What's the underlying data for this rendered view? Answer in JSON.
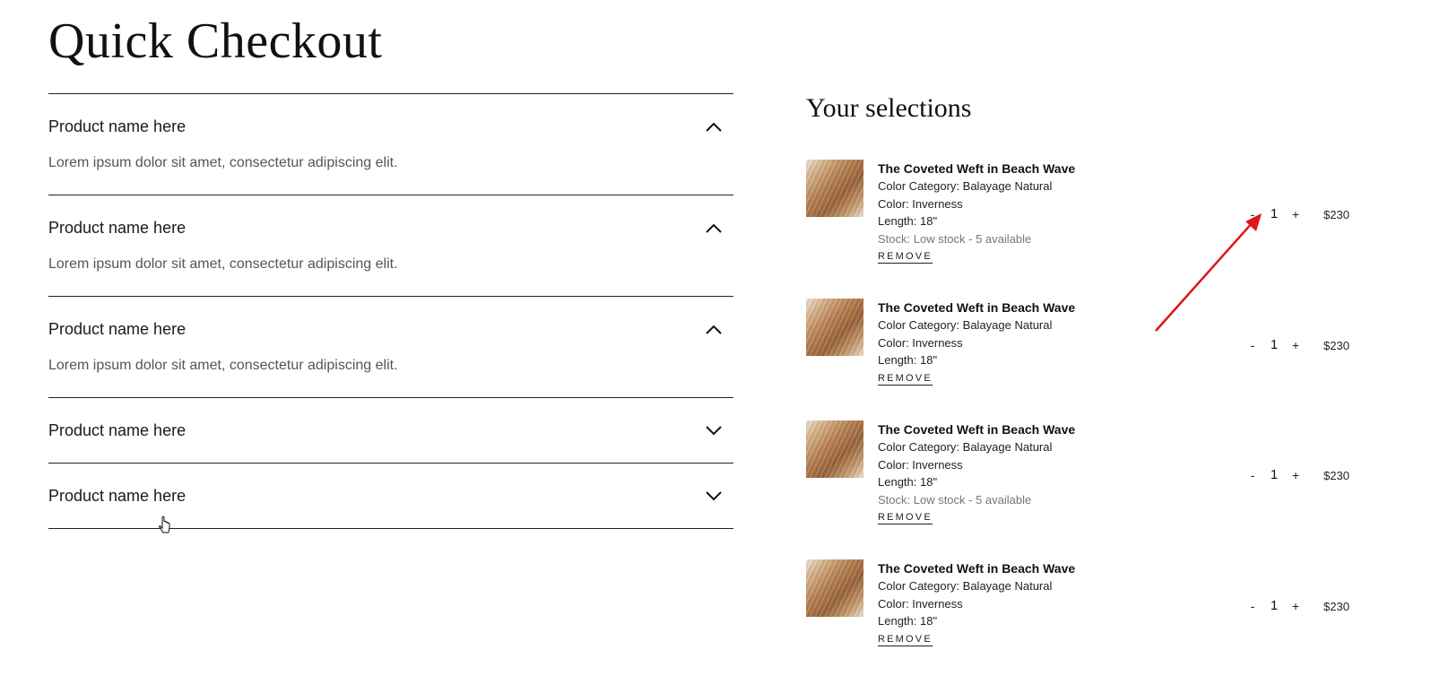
{
  "page_title": "Quick Checkout",
  "accordion": [
    {
      "title": "Product name here",
      "expanded": true,
      "body": "Lorem ipsum dolor sit amet, consectetur adipiscing elit."
    },
    {
      "title": "Product name here",
      "expanded": true,
      "body": "Lorem ipsum dolor sit amet, consectetur adipiscing elit."
    },
    {
      "title": "Product name here",
      "expanded": true,
      "body": "Lorem ipsum dolor sit amet, consectetur adipiscing elit."
    },
    {
      "title": "Product name here",
      "expanded": false
    },
    {
      "title": "Product name here",
      "expanded": false
    }
  ],
  "selections": {
    "title": "Your selections",
    "items": [
      {
        "name": "The Coveted Weft in Beach Wave",
        "color_category": "Color Category: Balayage Natural",
        "color": "Color: Inverness",
        "length": "Length: 18\"",
        "stock": "Stock: Low stock - 5 available",
        "remove_label": "REMOVE",
        "qty_minus": "-",
        "quantity": "1",
        "qty_plus": "+",
        "price": "$230"
      },
      {
        "name": "The Coveted Weft in Beach Wave",
        "color_category": "Color Category: Balayage Natural",
        "color": "Color: Inverness",
        "length": "Length: 18\"",
        "remove_label": "REMOVE",
        "qty_minus": "-",
        "quantity": "1",
        "qty_plus": "+",
        "price": "$230"
      },
      {
        "name": "The Coveted Weft in Beach Wave",
        "color_category": "Color Category: Balayage Natural",
        "color": "Color: Inverness",
        "length": "Length: 18\"",
        "stock": "Stock: Low stock - 5 available",
        "remove_label": "REMOVE",
        "qty_minus": "-",
        "quantity": "1",
        "qty_plus": "+",
        "price": "$230"
      },
      {
        "name": "The Coveted Weft in Beach Wave",
        "color_category": "Color Category: Balayage Natural",
        "color": "Color: Inverness",
        "length": "Length: 18\"",
        "remove_label": "REMOVE",
        "qty_minus": "-",
        "quantity": "1",
        "qty_plus": "+",
        "price": "$230"
      }
    ]
  },
  "colors": {
    "annotation_arrow": "#e0141b",
    "divider": "#222222"
  },
  "icons": {
    "expanded": "chevron-up-icon",
    "collapsed": "chevron-down-icon",
    "annotation": "red-arrow-annotation",
    "pointer": "mouse-cursor-icon"
  }
}
